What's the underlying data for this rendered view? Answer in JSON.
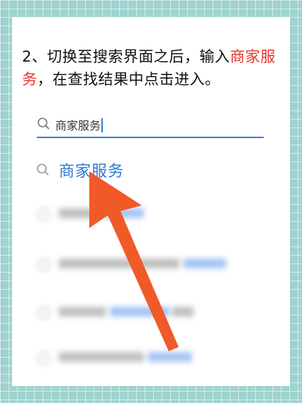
{
  "instruction": {
    "prefix": "2、切换至搜索界面之后，输入",
    "highlight": "商家服务",
    "suffix": "，在查找结果中点击进入。"
  },
  "search": {
    "query": "商家服务"
  },
  "results": {
    "top_label": "商家服务"
  },
  "colors": {
    "accent_blue": "#2f7de1",
    "highlight_red": "#e8332b",
    "arrow_orange": "#f05a28"
  }
}
